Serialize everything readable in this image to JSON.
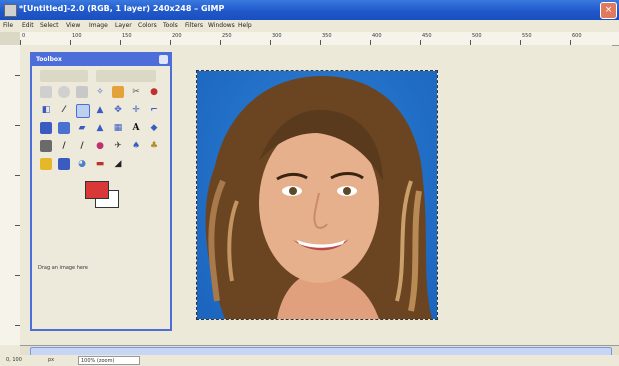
{
  "window": {
    "title": "*[Untitled]-2.0 (RGB, 1 layer) 240x248 – GIMP",
    "close_label": "×"
  },
  "menubar": {
    "items": [
      "File",
      "Edit",
      "Select",
      "View",
      "Image",
      "Layer",
      "Colors",
      "Tools",
      "Filters",
      "Windows",
      "Help"
    ]
  },
  "ruler": {
    "labels": [
      "0",
      "100",
      "150",
      "200",
      "250",
      "300",
      "350",
      "400",
      "450",
      "500",
      "550",
      "600"
    ]
  },
  "toolbox": {
    "title": "Toolbox",
    "status_text": "Drag an image here",
    "foreground_color": "#d93838",
    "background_color": "#ffffff"
  },
  "statusbar": {
    "coords": "0, 100",
    "unit": "px",
    "field": "100% (zoom)"
  }
}
